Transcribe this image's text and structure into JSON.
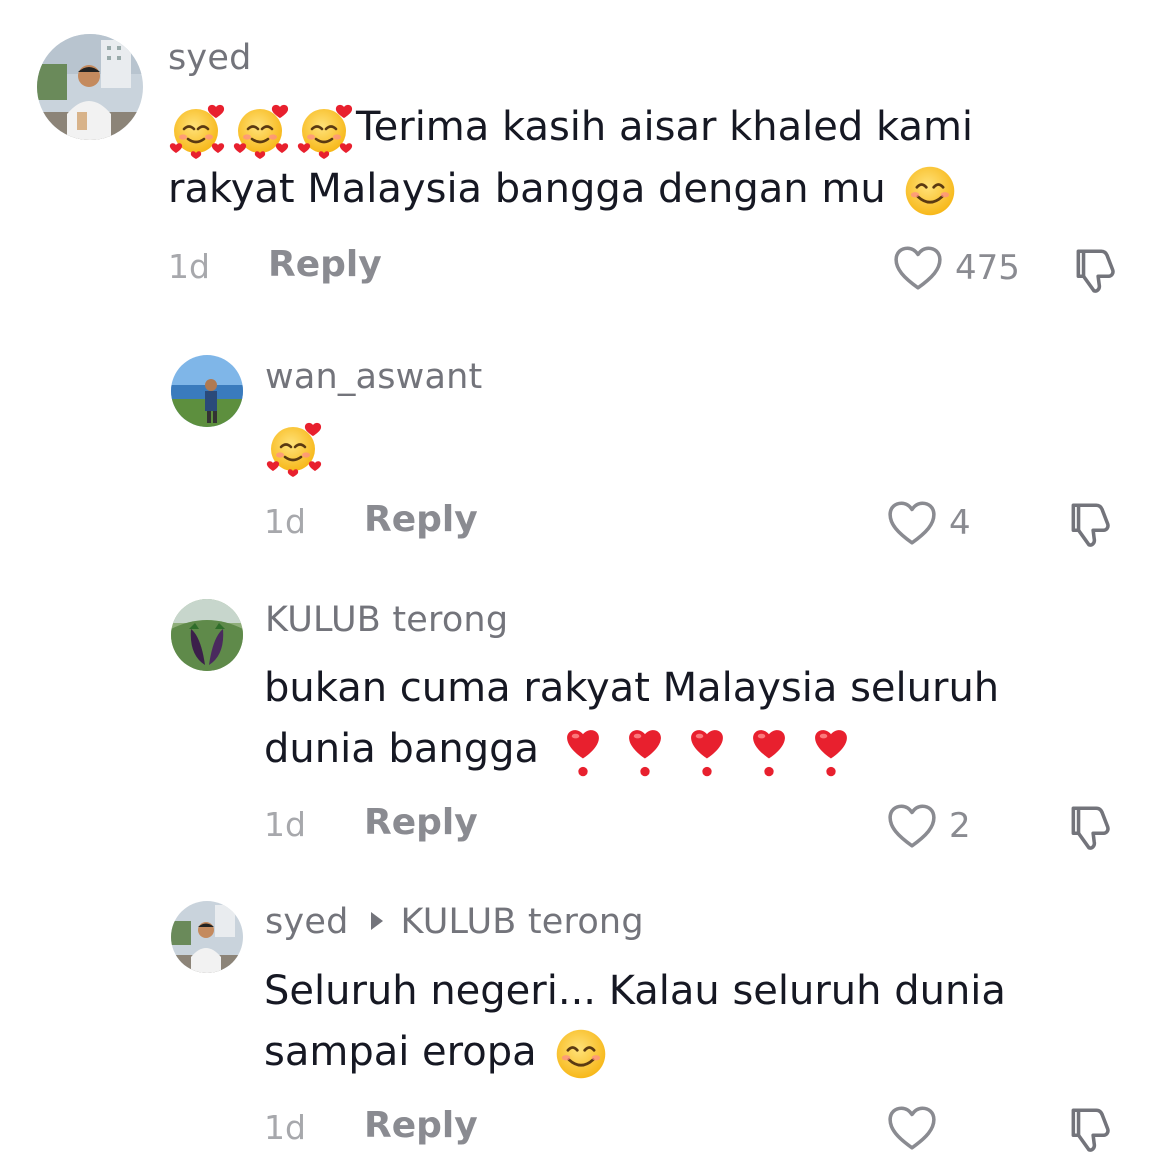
{
  "comments": [
    {
      "username": "syed",
      "line1": "Terima kasih aisar khaled kami",
      "line2": "rakyat Malaysia bangga dengan mu",
      "time": "1d",
      "reply_label": "Reply",
      "likes": "475",
      "emojis_lead": [
        "smiling-face-with-hearts",
        "smiling-face-with-hearts",
        "smiling-face-with-hearts"
      ],
      "emoji_trail": "smiling-face-with-smiling-eyes"
    },
    {
      "username": "wan_aswant",
      "time": "1d",
      "reply_label": "Reply",
      "likes": "4",
      "emojis": [
        "smiling-face-with-hearts"
      ]
    },
    {
      "username": "KULUB terong",
      "line1": "bukan cuma rakyat Malaysia seluruh",
      "line2": "dunia bangga",
      "time": "1d",
      "reply_label": "Reply",
      "likes": "2",
      "emojis_trail": [
        "heart-exclamation",
        "heart-exclamation",
        "heart-exclamation",
        "heart-exclamation",
        "heart-exclamation"
      ]
    },
    {
      "username": "syed",
      "reply_to": "KULUB terong",
      "line1": "Seluruh negeri... Kalau seluruh dunia",
      "line2": "sampai eropa",
      "time": "1d",
      "reply_label": "Reply",
      "likes": "",
      "emoji_trail": "smiling-face-with-smiling-eyes"
    }
  ],
  "colors": {
    "text": "#161823",
    "username": "#73747b",
    "meta": "#8a8b91",
    "emoji_yellow": "#ffc83d",
    "heart_red": "#e8202e"
  }
}
